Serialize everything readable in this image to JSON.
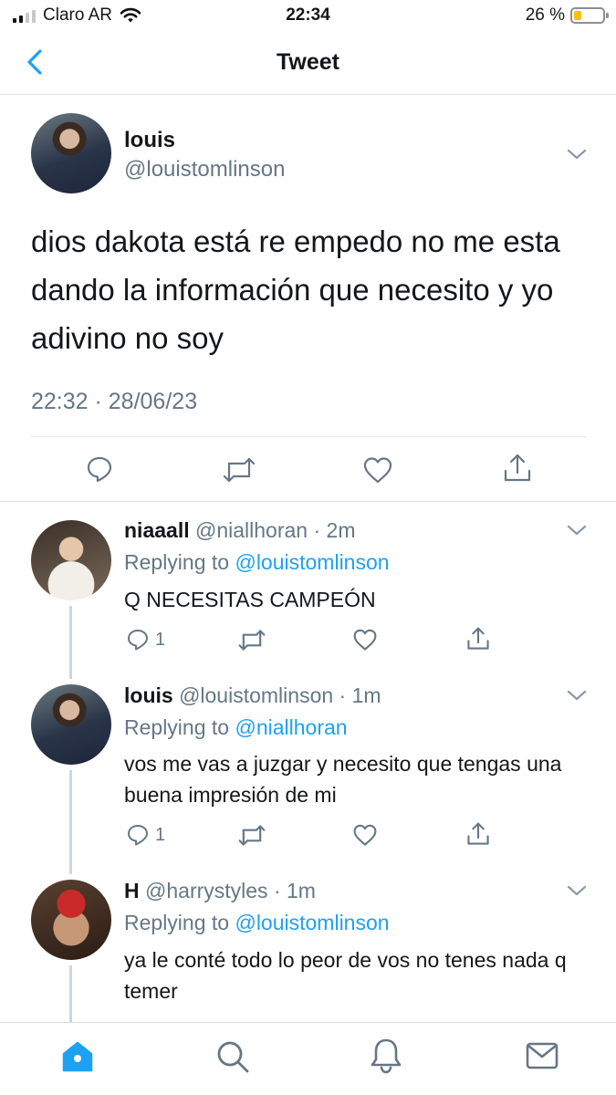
{
  "status_bar": {
    "carrier": "Claro AR",
    "time": "22:34",
    "battery_percent": "26 %",
    "battery_level": 0.26
  },
  "nav": {
    "title": "Tweet"
  },
  "main_tweet": {
    "name": "louis",
    "handle": "@louistomlinson",
    "text": "dios dakota está re empedo no me esta dando la información que necesito y yo adivino no soy",
    "timestamp": "22:32 · 28/06/23"
  },
  "replies": [
    {
      "name": "niaaall",
      "handle": "@niallhoran",
      "time": "· 2m",
      "replying_prefix": "Replying to",
      "replying_to": "@louistomlinson",
      "text": "Q NECESITAS CAMPEÓN",
      "reply_count": "1"
    },
    {
      "name": "louis",
      "handle": "@louistomlinson",
      "time": "· 1m",
      "replying_prefix": "Replying to",
      "replying_to": "@niallhoran",
      "text": "vos me vas a juzgar y necesito que tengas una buena impresión de mi",
      "reply_count": "1"
    },
    {
      "name": "H",
      "handle": "@harrystyles",
      "time": "· 1m",
      "replying_prefix": "Replying to",
      "replying_to": "@louistomlinson",
      "text": "ya le conté todo lo peor de vos no tenes nada q temer",
      "reply_count": ""
    }
  ],
  "tab_bar": {
    "active": "home",
    "icons": [
      "home-icon",
      "search-icon",
      "notifications-icon",
      "messages-icon"
    ]
  },
  "colors": {
    "accent": "#1da1f2",
    "secondary_text": "#657786",
    "divider": "#e1e8ed"
  }
}
